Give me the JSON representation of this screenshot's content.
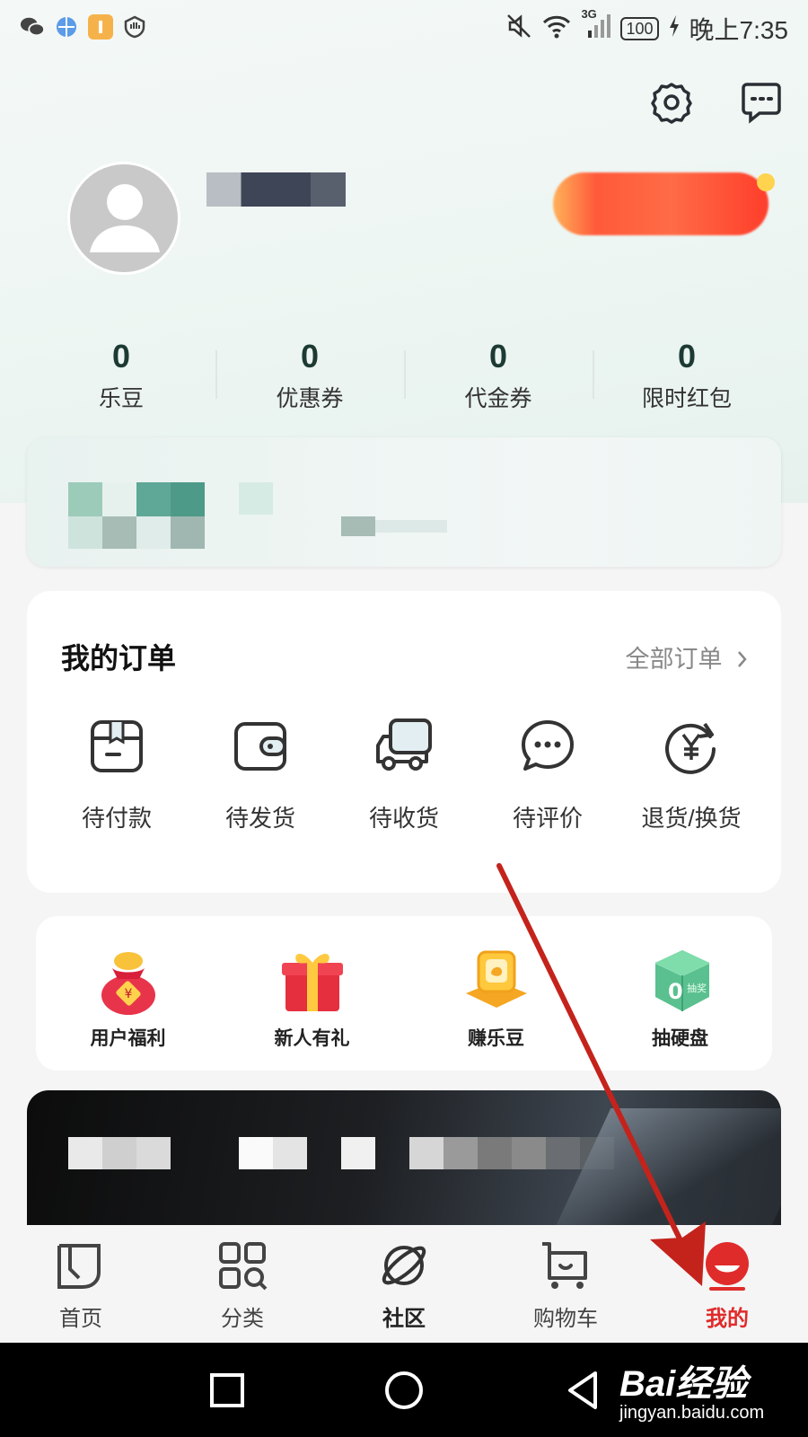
{
  "status_bar": {
    "network": "3G",
    "battery": "100",
    "time": "晚上7:35"
  },
  "stats": [
    {
      "value": "0",
      "label": "乐豆"
    },
    {
      "value": "0",
      "label": "优惠券"
    },
    {
      "value": "0",
      "label": "代金券"
    },
    {
      "value": "0",
      "label": "限时红包"
    }
  ],
  "orders": {
    "title": "我的订单",
    "all_label": "全部订单",
    "items": [
      {
        "label": "待付款",
        "icon": "wallet-box-icon"
      },
      {
        "label": "待发货",
        "icon": "wallet-icon"
      },
      {
        "label": "待收货",
        "icon": "truck-icon"
      },
      {
        "label": "待评价",
        "icon": "chat-bubble-icon"
      },
      {
        "label": "退货/换货",
        "icon": "refund-yen-icon"
      }
    ]
  },
  "benefits": [
    {
      "label": "用户福利",
      "icon": "lucky-bag-icon"
    },
    {
      "label": "新人有礼",
      "icon": "gift-box-icon"
    },
    {
      "label": "赚乐豆",
      "icon": "coin-machine-icon"
    },
    {
      "label": "抽硬盘",
      "icon": "lottery-cube-icon",
      "cube_text": "0",
      "cube_side_text": "抽奖"
    }
  ],
  "tabbar": [
    {
      "label": "首页",
      "icon": "home-icon",
      "state": "normal"
    },
    {
      "label": "分类",
      "icon": "category-grid-icon",
      "state": "normal"
    },
    {
      "label": "社区",
      "icon": "planet-icon",
      "state": "bold"
    },
    {
      "label": "购物车",
      "icon": "cart-icon",
      "state": "normal"
    },
    {
      "label": "我的",
      "icon": "profile-icon",
      "state": "active"
    }
  ],
  "watermark": {
    "logo": "Bai经验",
    "url": "jingyan.baidu.com"
  },
  "colors": {
    "active_tab": "#e02b2b",
    "arrow": "#c4231c",
    "stat_value": "#1c3a33"
  }
}
